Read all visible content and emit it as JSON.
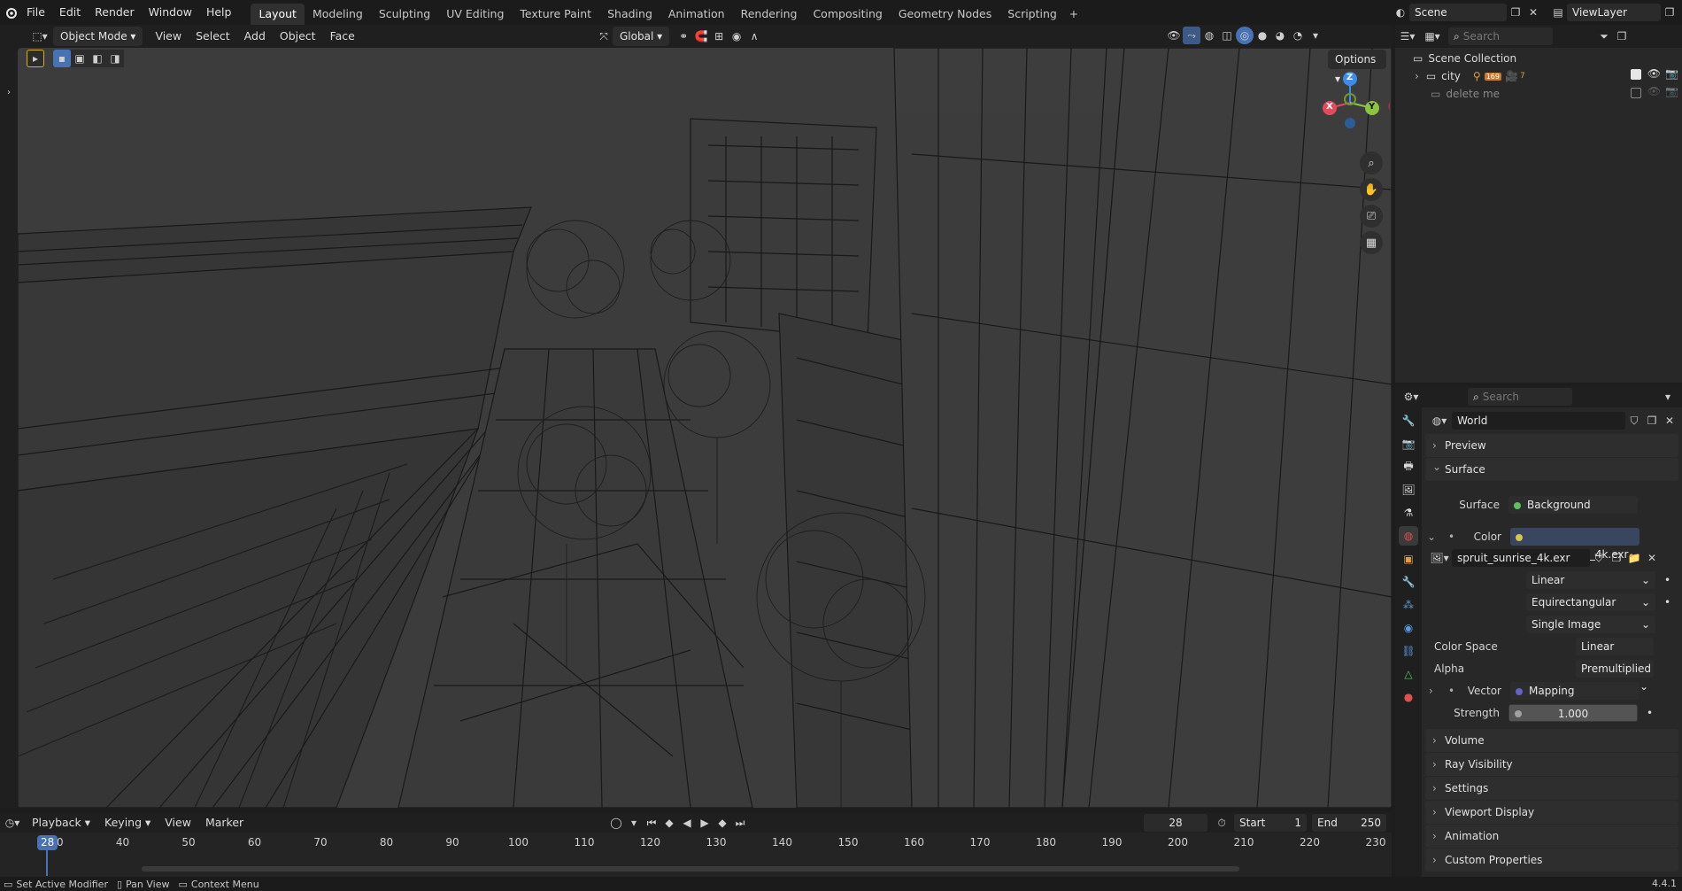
{
  "topbar": {
    "menus": [
      "File",
      "Edit",
      "Render",
      "Window",
      "Help"
    ],
    "workspaces": [
      "Layout",
      "Modeling",
      "Sculpting",
      "UV Editing",
      "Texture Paint",
      "Shading",
      "Animation",
      "Rendering",
      "Compositing",
      "Geometry Nodes",
      "Scripting"
    ],
    "active_workspace": "Layout",
    "scene": "Scene",
    "view_layer": "ViewLayer"
  },
  "viewport_header": {
    "mode": "Object Mode",
    "menus": [
      "View",
      "Select",
      "Add",
      "Object",
      "Face"
    ],
    "transform_orientation": "Global",
    "options": "Options"
  },
  "outliner": {
    "search_placeholder": "Search",
    "root": "Scene Collection",
    "items": [
      {
        "name": "city",
        "count": "169",
        "sub": "7"
      },
      {
        "name": "delete me"
      }
    ]
  },
  "properties": {
    "search_placeholder": "Search",
    "world_name": "World",
    "panels": {
      "preview": "Preview",
      "surface": "Surface",
      "volume": "Volume",
      "ray_visibility": "Ray Visibility",
      "settings": "Settings",
      "viewport_display": "Viewport Display",
      "animation": "Animation",
      "custom_properties": "Custom Properties"
    },
    "surface_label": "Surface",
    "surface_value": "Background",
    "color_label": "Color",
    "color_value": "spruit_sunrise_4k.exr",
    "image_name": "spruit_sunrise_4k.exr",
    "interpolation": "Linear",
    "projection": "Equirectangular",
    "source": "Single Image",
    "color_space_label": "Color Space",
    "color_space": "Linear Rec....",
    "alpha_label": "Alpha",
    "alpha": "Premultiplied",
    "vector_label": "Vector",
    "vector_value": "Mapping",
    "strength_label": "Strength",
    "strength_value": "1.000"
  },
  "timeline": {
    "menus": [
      "Playback",
      "Keying",
      "View",
      "Marker"
    ],
    "current_frame": "28",
    "start_label": "Start",
    "start": "1",
    "end_label": "End",
    "end": "250",
    "ticks": [
      "30",
      "40",
      "50",
      "60",
      "70",
      "80",
      "90",
      "100",
      "110",
      "120",
      "130",
      "140",
      "150",
      "160",
      "170",
      "180",
      "190",
      "200",
      "210",
      "220",
      "230"
    ],
    "playhead": "28"
  },
  "statusbar": {
    "hints": [
      "Set Active Modifier",
      "Pan View",
      "Context Menu"
    ],
    "version": "4.4.1"
  },
  "gizmo": {
    "x": "X",
    "y": "Y",
    "z": "Z"
  },
  "colors": {
    "accent": "#4772b3",
    "x_axis": "#e54a5c",
    "y_axis": "#8bc53f",
    "z_axis": "#3d8bea"
  }
}
